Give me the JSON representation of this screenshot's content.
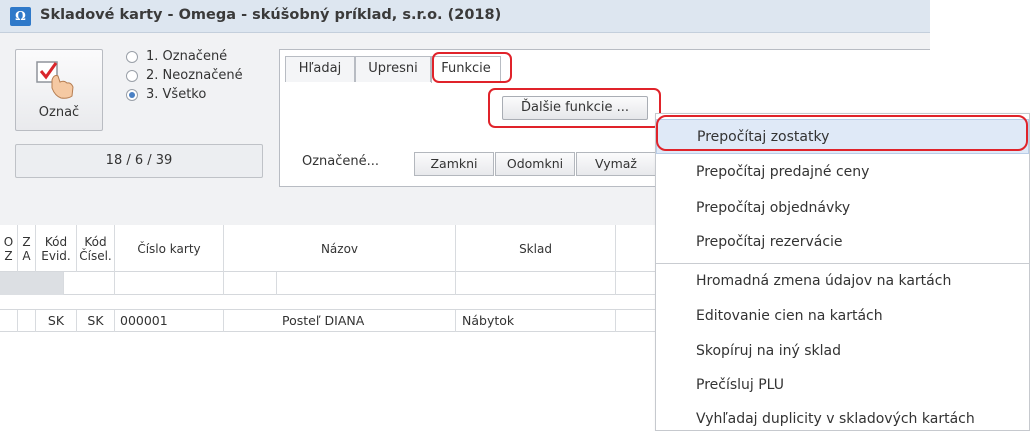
{
  "window": {
    "title": "Skladové karty - Omega - skúšobný príklad, s.r.o. (2018)",
    "icon": "omega-app-icon"
  },
  "mark_button": {
    "label": "Označ",
    "icon": "checkbox-hand-icon"
  },
  "filter_radios": [
    {
      "label": "1. Označené",
      "checked": false
    },
    {
      "label": "2. Neoznačené",
      "checked": false
    },
    {
      "label": "3. Všetko",
      "checked": true
    }
  ],
  "counter": "18 / 6 / 39",
  "tabs": [
    {
      "label": "Hľadaj",
      "active": false
    },
    {
      "label": "Upresni",
      "active": false
    },
    {
      "label": "Funkcie",
      "active": true
    }
  ],
  "functions": {
    "more_button": "Ďalšie funkcie ...",
    "marked_label": "Označené...",
    "buttons": [
      "Zamkni",
      "Odomkni",
      "Vymaž"
    ]
  },
  "grid": {
    "columns": [
      "O\nZ",
      "Z\nA",
      "Kód\nEvid.",
      "Kód\nČísel.",
      "Číslo karty",
      "Názov",
      "Sklad",
      ""
    ],
    "rows": [
      [
        "",
        "",
        "SK",
        "SK",
        "000001",
        "Posteľ DIANA",
        "Nábytok",
        ""
      ]
    ]
  },
  "dropdown": {
    "items": [
      {
        "label": "Prepočítaj zostatky",
        "selected": true
      },
      {
        "label": "Prepočítaj predajné ceny",
        "selected": false
      },
      {
        "label": "Prepočítaj objednávky",
        "selected": false
      },
      {
        "label": "Prepočítaj rezervácie",
        "selected": false
      },
      {
        "label": "Hromadná zmena údajov na kartách",
        "selected": false
      },
      {
        "label": "Editovanie cien na kartách",
        "selected": false
      },
      {
        "label": "Skopíruj na iný sklad",
        "selected": false
      },
      {
        "label": "Prečísluj PLU",
        "selected": false
      },
      {
        "label": "Vyhľadaj duplicity v skladových kartách",
        "selected": false
      }
    ]
  },
  "colors": {
    "highlight": "#e0232a",
    "menu_selected": "#dfe9f7",
    "app_icon": "#2f79c9"
  }
}
